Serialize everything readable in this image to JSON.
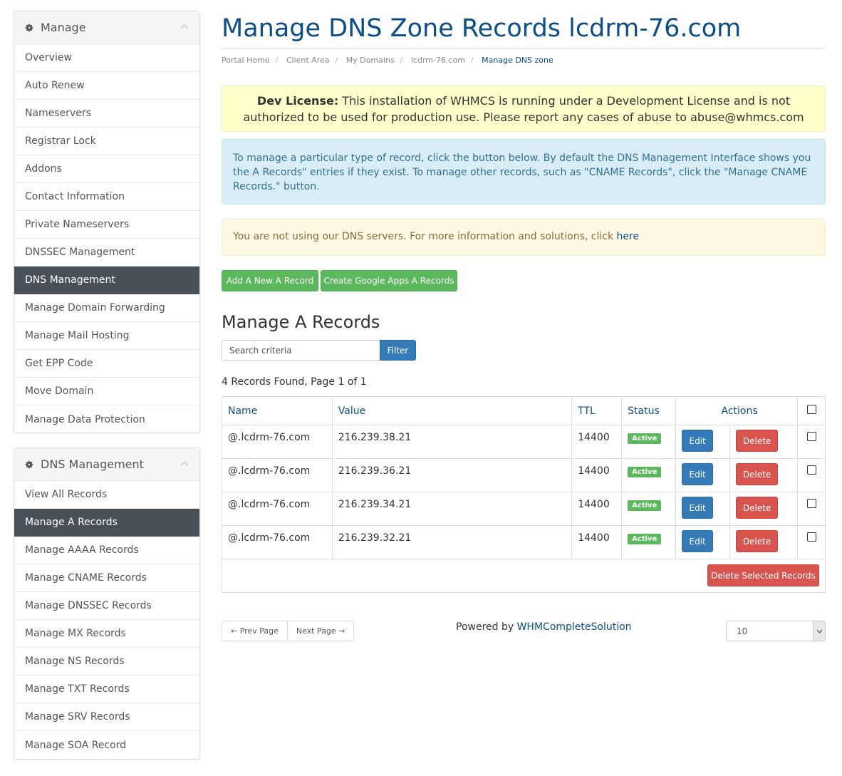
{
  "sidebar": {
    "manage": {
      "title": "Manage",
      "items": [
        {
          "label": "Overview"
        },
        {
          "label": "Auto Renew"
        },
        {
          "label": "Nameservers"
        },
        {
          "label": "Registrar Lock"
        },
        {
          "label": "Addons"
        },
        {
          "label": "Contact Information"
        },
        {
          "label": "Private Nameservers"
        },
        {
          "label": "DNSSEC Management"
        },
        {
          "label": "DNS Management",
          "active": true
        },
        {
          "label": "Manage Domain Forwarding"
        },
        {
          "label": "Manage Mail Hosting"
        },
        {
          "label": "Get EPP Code"
        },
        {
          "label": "Move Domain"
        },
        {
          "label": "Manage Data Protection"
        }
      ]
    },
    "dns": {
      "title": "DNS Management",
      "items": [
        {
          "label": "View All Records"
        },
        {
          "label": "Manage A Records",
          "active": true
        },
        {
          "label": "Manage AAAA Records"
        },
        {
          "label": "Manage CNAME Records"
        },
        {
          "label": "Manage DNSSEC Records"
        },
        {
          "label": "Manage MX Records"
        },
        {
          "label": "Manage NS Records"
        },
        {
          "label": "Manage TXT Records"
        },
        {
          "label": "Manage SRV Records"
        },
        {
          "label": "Manage SOA Record"
        }
      ]
    }
  },
  "page": {
    "title": "Manage DNS Zone Records lcdrm-76.com",
    "breadcrumb": [
      "Portal Home",
      "Client Area",
      "My Domains",
      "lcdrm-76.com",
      "Manage DNS zone"
    ]
  },
  "alerts": {
    "license_bold": "Dev License:",
    "license_text": " This installation of WHMCS is running under a Development License and is not authorized to be used for production use. Please report any cases of abuse to abuse@whmcs.com",
    "info_text": "To manage a particular type of record, click the button below. By default the DNS Management Interface shows you the  A Records\" entries if they exist. To manage other records, such as \"CNAME Records\", click the \"Manage CNAME Records.\" button.",
    "warn_text": "You are not using our DNS servers. For more information and solutions, click ",
    "warn_link": "here"
  },
  "buttons": {
    "add_record": "Add A New A Record",
    "google_apps": "Create Google Apps A Records",
    "filter": "Filter",
    "delete_selected": "Delete Selected Records",
    "edit": "Edit",
    "delete": "Delete"
  },
  "records_section": {
    "title": "Manage A Records",
    "search_placeholder": "Search criteria",
    "count_text": "4 Records Found, Page 1 of 1"
  },
  "table": {
    "headers": {
      "name": "Name",
      "value": "Value",
      "ttl": "TTL",
      "status": "Status",
      "actions": "Actions"
    },
    "rows": [
      {
        "name": "@.lcdrm-76.com",
        "value": "216.239.38.21",
        "ttl": "14400",
        "status": "Active"
      },
      {
        "name": "@.lcdrm-76.com",
        "value": "216.239.36.21",
        "ttl": "14400",
        "status": "Active"
      },
      {
        "name": "@.lcdrm-76.com",
        "value": "216.239.34.21",
        "ttl": "14400",
        "status": "Active"
      },
      {
        "name": "@.lcdrm-76.com",
        "value": "216.239.32.21",
        "ttl": "14400",
        "status": "Active"
      }
    ]
  },
  "footer": {
    "prev": "← Prev Page",
    "next": "Next Page →",
    "powered_prefix": "Powered by ",
    "powered_link": "WHMCompleteSolution",
    "page_size": "10"
  },
  "colors": {
    "accent": "#0c4e87",
    "active_menu": "#485157",
    "green": "#5cb85c",
    "blue": "#337ab7",
    "red": "#d9534f"
  },
  "icons": {
    "panel_heading": "gear-icon",
    "panel_collapse": "chevron-up-icon",
    "select_arrow": "chevron-down-icon"
  }
}
